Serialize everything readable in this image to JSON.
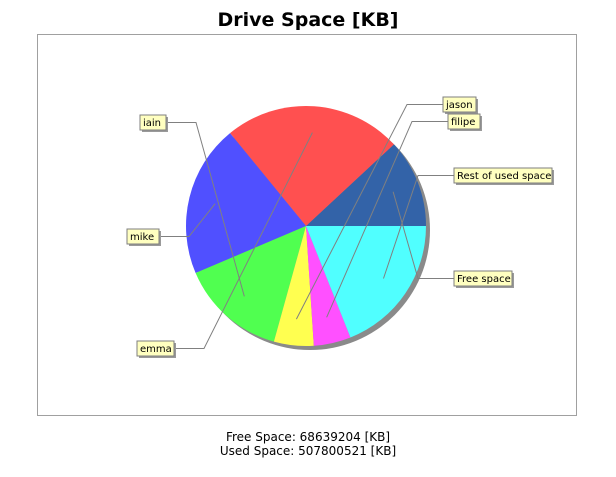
{
  "chart_data": {
    "type": "pie",
    "title": "Drive Space [KB]",
    "slices": [
      {
        "label": "Free space",
        "fraction": 0.1191,
        "color": "#3363a8"
      },
      {
        "label": "emma",
        "fraction": 0.24,
        "color": "#ff5050"
      },
      {
        "label": "mike",
        "fraction": 0.205,
        "color": "#5050ff"
      },
      {
        "label": "iain",
        "fraction": 0.1428,
        "color": "#50ff50"
      },
      {
        "label": "jason",
        "fraction": 0.0535,
        "color": "#ffff50"
      },
      {
        "label": "filipe",
        "fraction": 0.05,
        "color": "#ff50ff"
      },
      {
        "label": "Rest of used space",
        "fraction": 0.1896,
        "color": "#50ffff"
      }
    ]
  },
  "footer": {
    "free_space": "Free Space: 68639204 [KB]",
    "used_space": "Used Space: 507800521 [KB]"
  }
}
